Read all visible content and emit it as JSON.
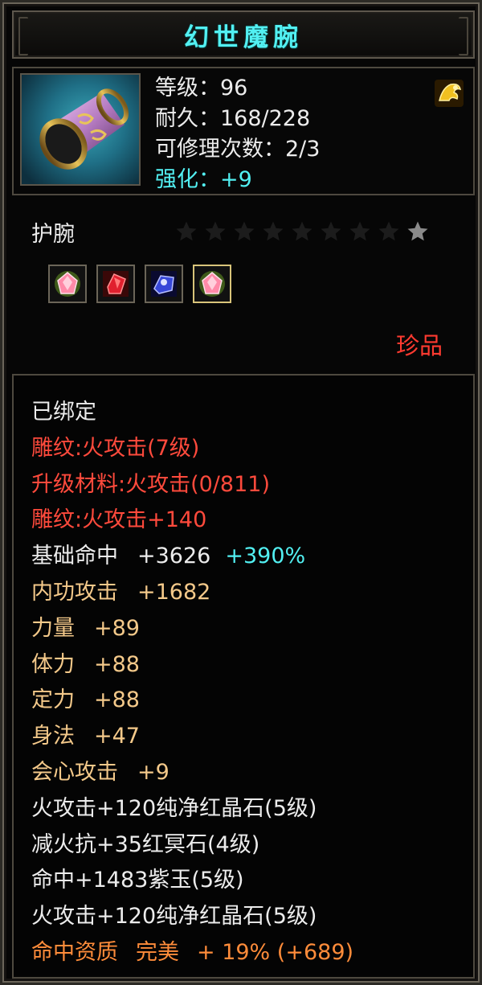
{
  "title": "幻世魔腕",
  "header": {
    "level_label": "等级：96",
    "durability_label": "耐久：168/228",
    "repair_label": "可修理次数：2/3",
    "enhance_label": "强化：+9",
    "badge_icon": "gold-treasure-icon"
  },
  "item_type": "护腕",
  "stars": {
    "total": 9,
    "filled": 1
  },
  "gems": [
    {
      "icon": "pink-gem-icon",
      "color": "#ff7a9a"
    },
    {
      "icon": "red-crystal-icon",
      "color": "#e02030"
    },
    {
      "icon": "blue-jade-icon",
      "color": "#3848d8"
    },
    {
      "icon": "pink-gem-icon",
      "color": "#ff7a9a"
    }
  ],
  "rarity": "珍品",
  "lines": {
    "bound": "已绑定",
    "engrave": "雕纹:火攻击(7级)",
    "upgrade_material": "升级材料:火攻击(0/811)",
    "engrave_bonus": "雕纹:火攻击+140",
    "hit_label": "基础命中",
    "hit_value": "+3626",
    "hit_pct": "+390%",
    "inner_atk_label": "内功攻击",
    "inner_atk_value": "+1682",
    "str_label": "力量",
    "str_value": "+89",
    "vit_label": "体力",
    "vit_value": "+88",
    "focus_label": "定力",
    "focus_value": "+88",
    "agi_label": "身法",
    "agi_value": "+47",
    "crit_label": "会心攻击",
    "crit_value": "+9",
    "socket1": "火攻击+120纯净红晶石(5级)",
    "socket2": "减火抗+35红冥石(4级)",
    "socket3": "命中+1483紫玉(5级)",
    "socket4": "火攻击+120纯净红晶石(5级)",
    "aptitude_label": "命中资质",
    "aptitude_quality": "完美",
    "aptitude_bonus": "+ 19% (+689)"
  },
  "colors": {
    "title": "#52f0f2",
    "red": "#ff4a3c",
    "gold": "#f4c98a",
    "orange": "#ff8c3a",
    "cyan": "#52f0f2"
  }
}
